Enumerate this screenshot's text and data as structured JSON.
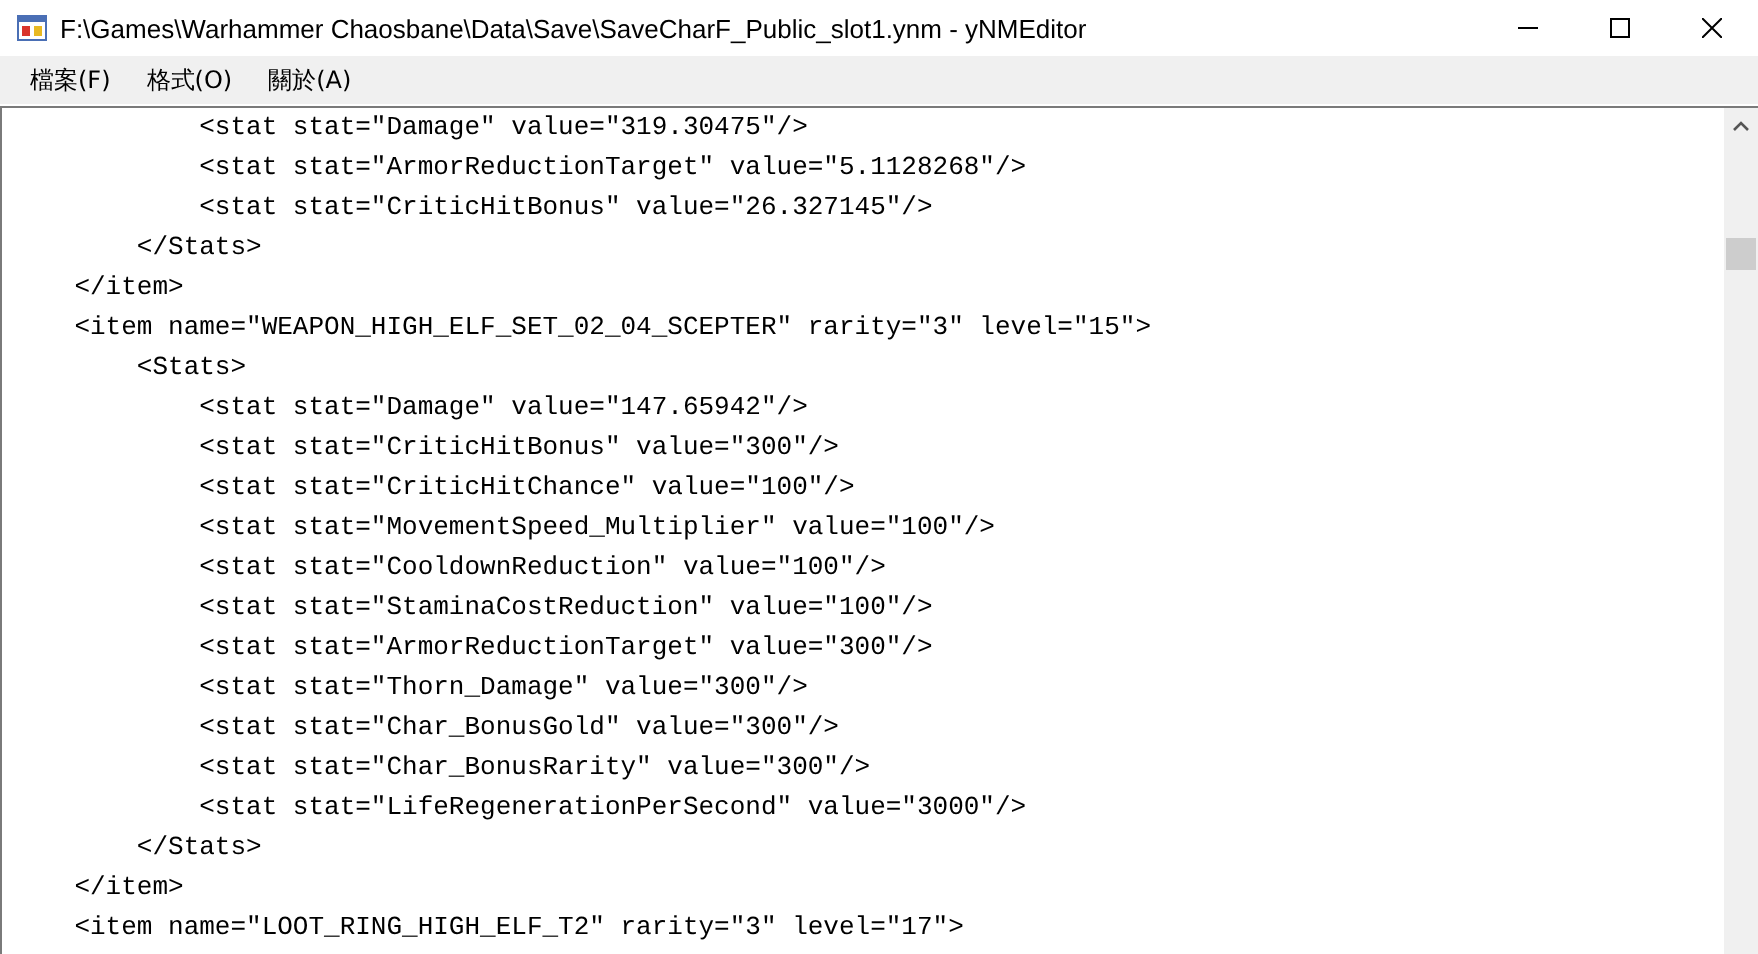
{
  "window": {
    "title": "F:\\Games\\Warhammer Chaosbane\\Data\\Save\\SaveCharF_Public_slot1.ynm - yNMEditor"
  },
  "menu": [
    "檔案(F)",
    "格式(O)",
    "關於(A)"
  ],
  "editor": {
    "lines": [
      "            <stat stat=\"Damage\" value=\"319.30475\"/>",
      "            <stat stat=\"ArmorReductionTarget\" value=\"5.1128268\"/>",
      "            <stat stat=\"CriticHitBonus\" value=\"26.327145\"/>",
      "        </Stats>",
      "    </item>",
      "    <item name=\"WEAPON_HIGH_ELF_SET_02_04_SCEPTER\" rarity=\"3\" level=\"15\">",
      "        <Stats>",
      "            <stat stat=\"Damage\" value=\"147.65942\"/>",
      "            <stat stat=\"CriticHitBonus\" value=\"300\"/>",
      "            <stat stat=\"CriticHitChance\" value=\"100\"/>",
      "            <stat stat=\"MovementSpeed_Multiplier\" value=\"100\"/>",
      "            <stat stat=\"CooldownReduction\" value=\"100\"/>",
      "            <stat stat=\"StaminaCostReduction\" value=\"100\"/>",
      "            <stat stat=\"ArmorReductionTarget\" value=\"300\"/>",
      "            <stat stat=\"Thorn_Damage\" value=\"300\"/>",
      "            <stat stat=\"Char_BonusGold\" value=\"300\"/>",
      "            <stat stat=\"Char_BonusRarity\" value=\"300\"/>",
      "            <stat stat=\"LifeRegenerationPerSecond\" value=\"3000\"/>",
      "        </Stats>",
      "    </item>",
      "    <item name=\"LOOT_RING_HIGH_ELF_T2\" rarity=\"3\" level=\"17\">"
    ]
  }
}
